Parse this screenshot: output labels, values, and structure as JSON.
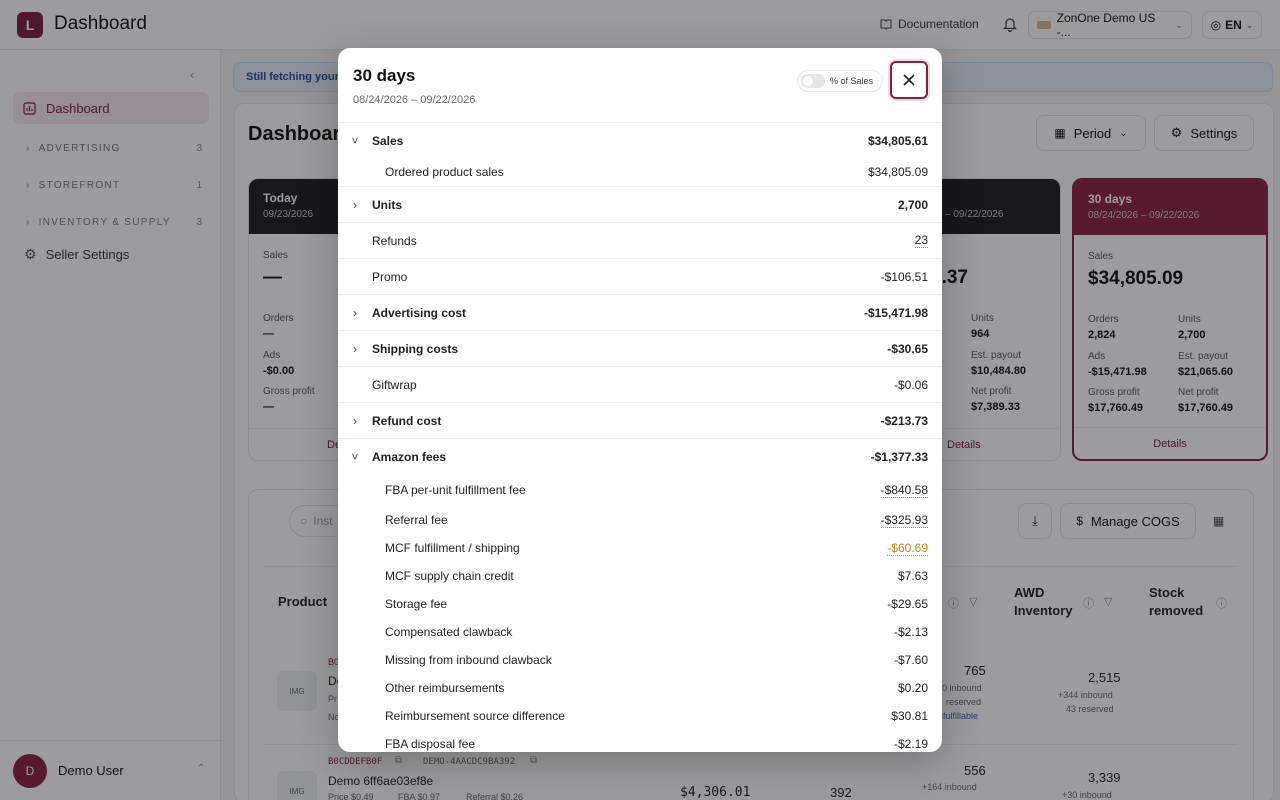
{
  "app": {
    "logo_letter": "L",
    "title": "Dashboard"
  },
  "topbar": {
    "documentation": "Documentation",
    "account": "ZonOne Demo US -...",
    "language": "EN"
  },
  "sidebar": {
    "active_item": "Dashboard",
    "groups": [
      {
        "label": "ADVERTISING",
        "count": "3"
      },
      {
        "label": "STOREFRONT",
        "count": "1"
      },
      {
        "label": "INVENTORY & SUPPLY",
        "count": "3"
      }
    ],
    "settings_item": "Seller Settings",
    "user": {
      "initial": "D",
      "name": "Demo User"
    }
  },
  "main": {
    "banner": "Still fetching your",
    "page_title": "Dashboard",
    "period_button": "Period",
    "settings_button": "Settings",
    "search_placeholder": "Inst",
    "manage_cogs": "Manage COGS"
  },
  "period_cards": {
    "today": {
      "title": "Today",
      "date": "09/23/2026",
      "sales_label": "Sales",
      "sales": "—",
      "orders_label": "Orders",
      "orders": "—",
      "ads_label": "Ads",
      "ads": "-$0.00",
      "gross_label": "Gross profit",
      "gross": "—",
      "details": "De"
    },
    "partial": {
      "date": "– 09/22/2026",
      "sales": "0.37",
      "units_label": "Units",
      "units": "964",
      "payout_label": "Est. payout",
      "payout": "$10,484.80",
      "net_label": "Net profit",
      "net": "$7,389.33",
      "details": "Details"
    },
    "thirty": {
      "title": "30 days",
      "date": "08/24/2026 – 09/22/2026",
      "sales_label": "Sales",
      "sales": "$34,805.09",
      "orders_label": "Orders",
      "orders": "2,824",
      "units_label": "Units",
      "units": "2,700",
      "ads_label": "Ads",
      "ads": "-$15,471.98",
      "payout_label": "Est. payout",
      "payout": "$21,065.60",
      "gross_label": "Gross profit",
      "gross": "$17,760.49",
      "net_label": "Net profit",
      "net": "$17,760.49",
      "details": "Details"
    }
  },
  "table": {
    "headers": {
      "product": "Product",
      "awd_1": "AWD",
      "awd_2": "Inventory",
      "stock_1": "Stock",
      "stock_2": "removed"
    },
    "row1": {
      "asin": "B0C",
      "name": "De",
      "price": "Pr",
      "note": "No",
      "inv": "765",
      "inv_inbound": "0 inbound",
      "inv_reserved": "reserved",
      "inv_unf": "nfulfillable",
      "awd": "2,515",
      "awd_inbound": "+344 inbound",
      "awd_reserved": "43 reserved"
    },
    "row2": {
      "asin": "B0CDDEFB0F",
      "sku": "DEMO-4AACDC9BA392",
      "name": "Demo 6ff6ae03ef8e",
      "price": "Price $0.49",
      "fba": "FBA $0.97",
      "referral": "Referral $0.26",
      "sales": "$4,306.01",
      "units": "392",
      "inv": "556",
      "inv_inbound": "+164 inbound",
      "awd": "3,339",
      "awd_inbound": "+30 inbound"
    },
    "img_label": "IMG"
  },
  "modal": {
    "title": "30 days",
    "date_range": "08/24/2026 – 09/22/2026",
    "toggle_label": "% of Sales",
    "rows": [
      {
        "label": "Sales",
        "amount": "$34,805.61",
        "bold": true,
        "chevron": "˅"
      },
      {
        "label": "Ordered product sales",
        "amount": "$34,805.09",
        "sub": true
      },
      {
        "label": "Units",
        "amount": "2,700",
        "bold": true,
        "chevron": "›"
      },
      {
        "label": "Refunds",
        "amount": "23",
        "dotted": true
      },
      {
        "label": "Promo",
        "amount": "-$106.51"
      },
      {
        "label": "Advertising cost",
        "amount": "-$15,471.98",
        "bold": true,
        "chevron": "›"
      },
      {
        "label": "Shipping costs",
        "amount": "-$30.65",
        "bold": true,
        "chevron": "›"
      },
      {
        "label": "Giftwrap",
        "amount": "-$0.06"
      },
      {
        "label": "Refund cost",
        "amount": "-$213.73",
        "bold": true,
        "chevron": "›"
      },
      {
        "label": "Amazon fees",
        "amount": "-$1,377.33",
        "bold": true,
        "chevron": "˅"
      },
      {
        "label": "FBA per-unit fulfillment fee",
        "amount": "-$840.58",
        "sub": true,
        "dotted": true
      },
      {
        "label": "Referral fee",
        "amount": "-$325.93",
        "sub": true,
        "dotted": true
      },
      {
        "label": "MCF fulfillment / shipping",
        "amount": "-$60.69",
        "sub": true,
        "warn": true
      },
      {
        "label": "MCF supply chain credit",
        "amount": "$7.63",
        "sub": true
      },
      {
        "label": "Storage fee",
        "amount": "-$29.65",
        "sub": true
      },
      {
        "label": "Compensated clawback",
        "amount": "-$2.13",
        "sub": true
      },
      {
        "label": "Missing from inbound clawback",
        "amount": "-$7.60",
        "sub": true
      },
      {
        "label": "Other reimbursements",
        "amount": "$0.20",
        "sub": true
      },
      {
        "label": "Reimbursement source difference",
        "amount": "$30.81",
        "sub": true
      },
      {
        "label": "FBA disposal fee",
        "amount": "-$2.19",
        "sub": true
      }
    ]
  },
  "colors": {
    "brand": "#8a2040",
    "dark_card": "#1d1d20",
    "banner_bg": "#e5eef9",
    "warn": "#b8860b"
  }
}
